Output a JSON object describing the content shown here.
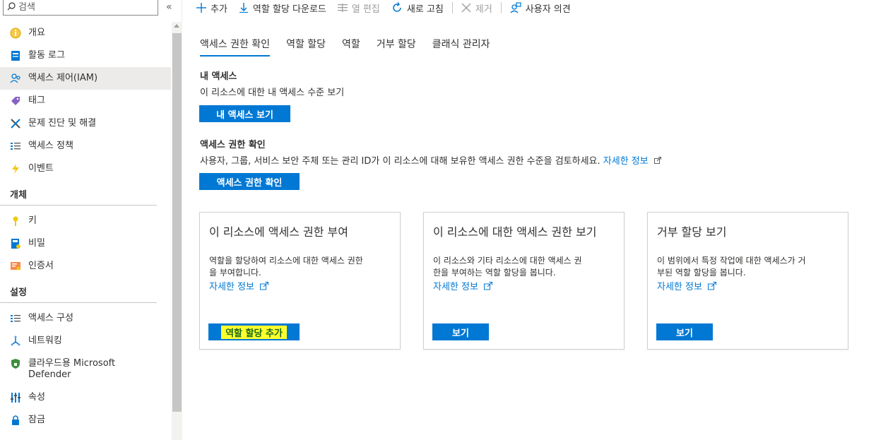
{
  "search": {
    "placeholder": "검색"
  },
  "sidebar": {
    "collapse_label": "«",
    "items": [
      {
        "label": "개요",
        "icon": "overview-icon"
      },
      {
        "label": "활동 로그",
        "icon": "activity-log-icon"
      },
      {
        "label": "액세스 제어(IAM)",
        "icon": "iam-icon",
        "active": true
      },
      {
        "label": "태그",
        "icon": "tag-icon"
      },
      {
        "label": "문제 진단 및 해결",
        "icon": "diagnose-icon"
      },
      {
        "label": "액세스 정책",
        "icon": "access-policy-icon"
      },
      {
        "label": "이벤트",
        "icon": "event-icon"
      }
    ],
    "section_objects": "개체",
    "objects_items": [
      {
        "label": "키",
        "icon": "key-icon"
      },
      {
        "label": "비밀",
        "icon": "secret-icon"
      },
      {
        "label": "인증서",
        "icon": "certificate-icon"
      }
    ],
    "section_settings": "설정",
    "settings_items": [
      {
        "label": "액세스 구성",
        "icon": "access-config-icon"
      },
      {
        "label": "네트워킹",
        "icon": "networking-icon"
      },
      {
        "label": "클라우드용 Microsoft Defender",
        "icon": "defender-icon"
      },
      {
        "label": "속성",
        "icon": "properties-icon"
      },
      {
        "label": "잠금",
        "icon": "lock-icon"
      }
    ]
  },
  "toolbar": {
    "add": "추가",
    "download": "역할 할당 다운로드",
    "edit_columns": "열 편집",
    "refresh": "새로 고침",
    "remove": "제거",
    "feedback": "사용자 의견"
  },
  "tabs": [
    "액세스 권한 확인",
    "역할 할당",
    "역할",
    "거부 할당",
    "클래식 관리자"
  ],
  "my_access": {
    "title": "내 액세스",
    "description": "이 리소스에 대한 내 액세스 수준 보기",
    "button": "내 액세스 보기"
  },
  "check_access": {
    "title": "액세스 권한 확인",
    "description": "사용자, 그룹, 서비스 보안 주체 또는 관리 ID가 이 리소스에 대해 보유한 액세스 권한 수준을 검토하세요.",
    "link": "자세한 정보",
    "button": "액세스 권한 확인"
  },
  "cards": [
    {
      "title": "이 리소스에 액세스 권한 부여",
      "desc_line1": "역할을 할당하여 리소스에 대한 액세스 권한",
      "desc_line2": "을 부여합니다.",
      "link": "자세한 정보",
      "button": "역할 할당 추가"
    },
    {
      "title": "이 리소스에 대한 액세스 권한 보기",
      "desc_line1": "이 리소스와 기타 리소스에 대한 액세스 권",
      "desc_line2": "한을 부여하는 역할 할당을 봅니다.",
      "link": "자세한 정보",
      "button": "보기"
    },
    {
      "title": "거부 할당 보기",
      "desc_line1": "이 범위에서 특정 작업에 대한 액세스가 거",
      "desc_line2": "부된 역할 할당을 봅니다.",
      "link": "자세한 정보",
      "button": "보기"
    }
  ],
  "colors": {
    "accent": "#0078d4",
    "highlight": "#fefe2e"
  }
}
